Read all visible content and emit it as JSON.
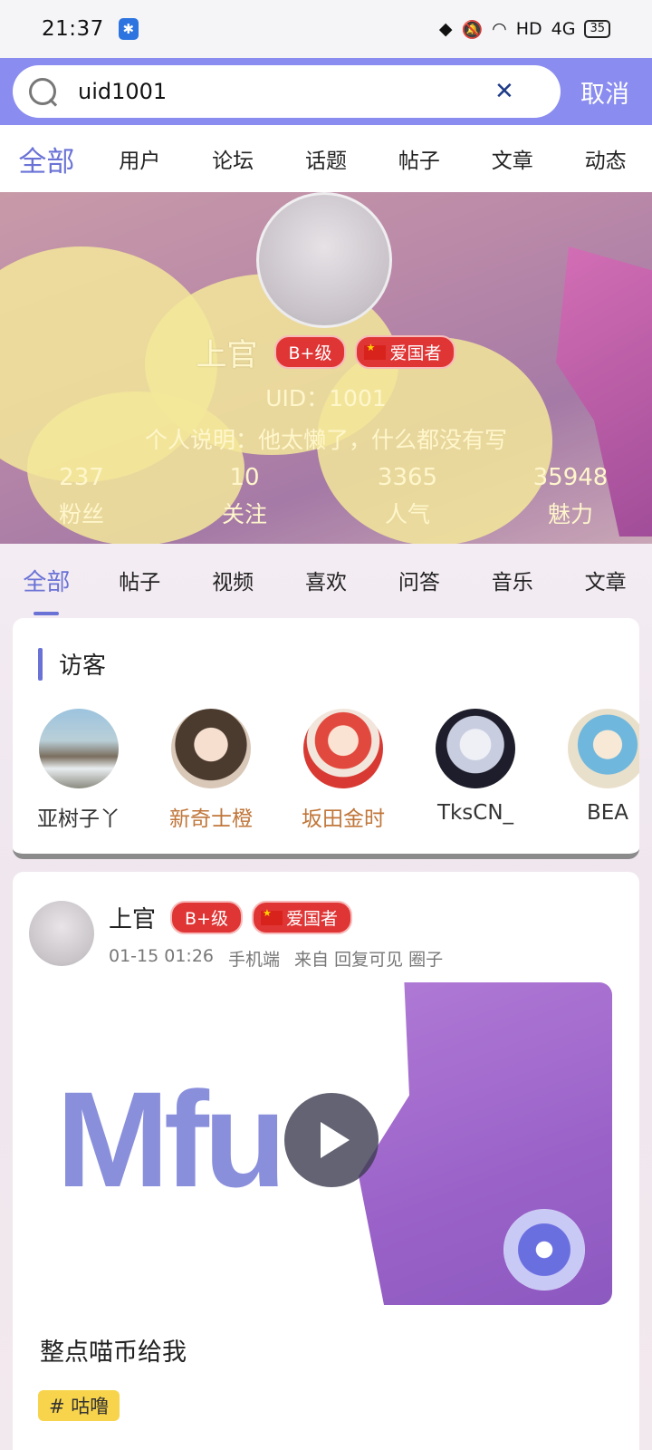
{
  "status_bar": {
    "time": "21:37",
    "network": "HD",
    "signal": "4G",
    "battery": "35"
  },
  "search": {
    "query": "uid1001",
    "cancel_label": "取消"
  },
  "top_tabs": [
    {
      "label": "全部",
      "active": true
    },
    {
      "label": "用户"
    },
    {
      "label": "论坛"
    },
    {
      "label": "话题"
    },
    {
      "label": "帖子"
    },
    {
      "label": "文章"
    },
    {
      "label": "动态"
    }
  ],
  "profile": {
    "name": "上官",
    "grade_badge": "B+级",
    "title_badge": "爱国者",
    "uid": "UID：1001",
    "description": "个人说明：他太懒了，什么都没有写",
    "stats": [
      {
        "value": "237",
        "label": "粉丝"
      },
      {
        "value": "10",
        "label": "关注"
      },
      {
        "value": "3365",
        "label": "人气"
      },
      {
        "value": "35948",
        "label": "魅力"
      }
    ]
  },
  "content_tabs": [
    {
      "label": "全部",
      "active": true
    },
    {
      "label": "帖子"
    },
    {
      "label": "视频"
    },
    {
      "label": "喜欢"
    },
    {
      "label": "问答"
    },
    {
      "label": "音乐"
    },
    {
      "label": "文章"
    }
  ],
  "visitors": {
    "title": "访客",
    "items": [
      {
        "name": "亚树子丫",
        "color": "#333333"
      },
      {
        "name": "新奇士橙",
        "color": "#c0763a"
      },
      {
        "name": "坂田金时",
        "color": "#c0763a"
      },
      {
        "name": "TksCN_",
        "color": "#333333"
      },
      {
        "name": "BEA",
        "color": "#333333"
      }
    ]
  },
  "post": {
    "author": "上官",
    "grade_badge": "B+级",
    "title_badge": "爱国者",
    "time": "01-15 01:26",
    "device": "手机端",
    "source": "来自 回复可见 圈子",
    "media_text": "Mfu",
    "title": "整点喵币给我",
    "tag": "# 咕噜"
  }
}
